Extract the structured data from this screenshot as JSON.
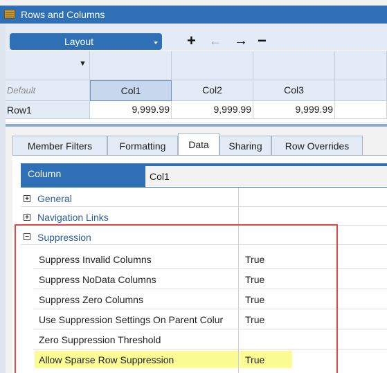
{
  "window": {
    "title": "Rows and Columns"
  },
  "toolbar": {
    "layout_label": "Layout",
    "add_glyph": "+",
    "back_glyph": "←",
    "forward_glyph": "→",
    "remove_glyph": "−"
  },
  "grid": {
    "filter_glyph": "▼",
    "default_label": "Default",
    "columns": [
      "Col1",
      "Col2",
      "Col3"
    ],
    "rows": [
      {
        "label": "Row1",
        "cells": [
          "9,999.99",
          "9,999.99",
          "9,999.99"
        ]
      }
    ]
  },
  "tabs": [
    "Member Filters",
    "Formatting",
    "Data",
    "Sharing",
    "Row Overrides"
  ],
  "active_tab": "Data",
  "column_selector": {
    "label": "Column",
    "value": "Col1"
  },
  "sections": {
    "general": "General",
    "navigation_links": "Navigation Links",
    "suppression": "Suppression"
  },
  "properties": [
    {
      "name": "Suppress Invalid Columns",
      "value": "True"
    },
    {
      "name": "Suppress NoData Columns",
      "value": "True"
    },
    {
      "name": "Suppress Zero Columns",
      "value": "True"
    },
    {
      "name": "Use Suppression Settings On Parent Colur",
      "value": "True"
    },
    {
      "name": "Zero Suppression Threshold",
      "value": ""
    },
    {
      "name": "Allow Sparse Row Suppression",
      "value": "True"
    }
  ],
  "colors": {
    "accent": "#2f6fb5",
    "highlight": "#fbfc94",
    "annotation_border": "#e64545"
  }
}
